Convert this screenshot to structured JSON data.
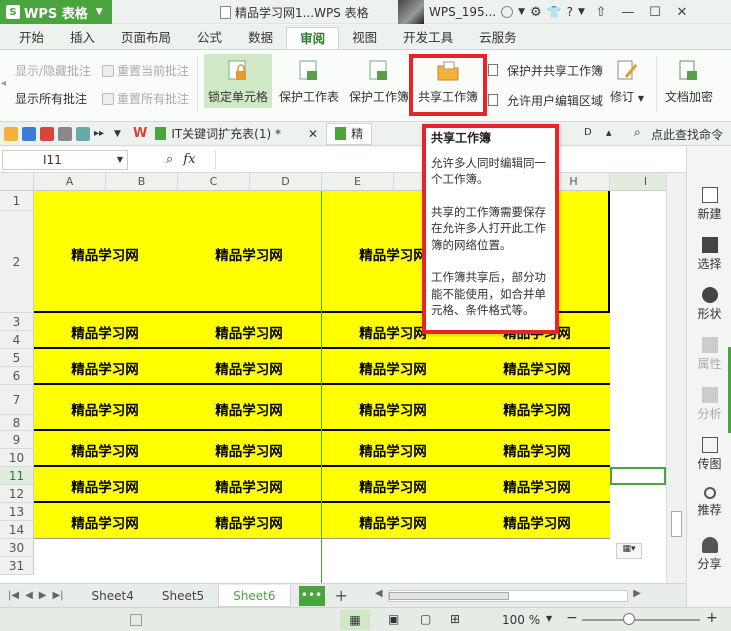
{
  "app": {
    "name": "WPS 表格",
    "doc_title": "精品学习网1...WPS 表格",
    "user": "WPS_195..."
  },
  "ribbon_tabs": [
    "开始",
    "插入",
    "页面布局",
    "公式",
    "数据",
    "审阅",
    "视图",
    "开发工具",
    "云服务"
  ],
  "active_tab": "审阅",
  "ribbon": {
    "show_hide_comment": "显示/隐藏批注",
    "show_all_comments": "显示所有批注",
    "reset_current_comment": "重置当前批注",
    "reset_all_comments": "重置所有批注",
    "lock_cells": "锁定单元格",
    "protect_sheet": "保护工作表",
    "protect_workbook": "保护工作簿",
    "share_workbook": "共享工作簿",
    "protect_share_workbook": "保护并共享工作簿",
    "allow_user_edit_ranges": "允许用户编辑区域",
    "revision": "修订",
    "doc_encrypt": "文档加密"
  },
  "doc_tabs": [
    {
      "label": "IT关键词扩充表(1) *"
    },
    {
      "label": "精"
    }
  ],
  "quick_search": "点此查找命令",
  "namebox": "I11",
  "fx": "fx",
  "columns": [
    "A",
    "B",
    "C",
    "D",
    "E",
    "F",
    "G",
    "H",
    "I"
  ],
  "rows": [
    "1",
    "2",
    "3",
    "4",
    "5",
    "6",
    "7",
    "8",
    "9",
    "10",
    "11",
    "12",
    "13",
    "14",
    "30",
    "31"
  ],
  "cell_text": "精品学习网",
  "sheets": [
    "Sheet4",
    "Sheet5",
    "Sheet6"
  ],
  "active_sheet": "Sheet6",
  "zoom": "100 %",
  "right_panel": [
    "新建",
    "选择",
    "形状",
    "属性",
    "分析",
    "传图",
    "推荐",
    "分享"
  ],
  "tooltip": {
    "title": "共享工作簿",
    "p1": "允许多人同时编辑同一个工作簿。",
    "p2": "共享的工作簿需要保存在允许多人打开此工作簿的网络位置。",
    "p3": "工作簿共享后，部分功能不能使用，如合并单元格、条件格式等。"
  },
  "colors": {
    "accent": "#4aa53e",
    "highlight": "#ffff00",
    "annotation": "#e8242b"
  }
}
